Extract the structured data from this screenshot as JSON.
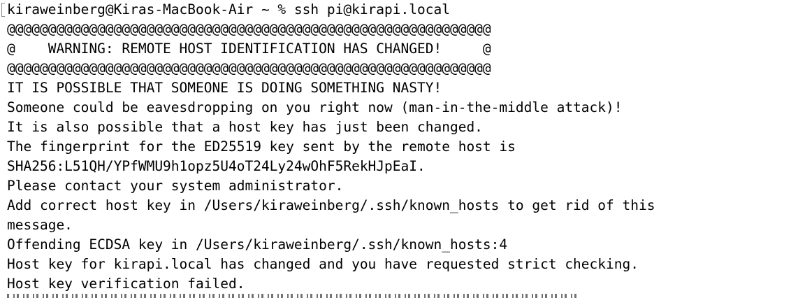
{
  "terminal": {
    "prompt": "kiraweinberg@Kiras-MacBook-Air ~ % ssh pi@kirapi.local",
    "output": [
      "@@@@@@@@@@@@@@@@@@@@@@@@@@@@@@@@@@@@@@@@@@@@@@@@@@@@@@@@@@@",
      "@    WARNING: REMOTE HOST IDENTIFICATION HAS CHANGED!     @",
      "@@@@@@@@@@@@@@@@@@@@@@@@@@@@@@@@@@@@@@@@@@@@@@@@@@@@@@@@@@@",
      "IT IS POSSIBLE THAT SOMEONE IS DOING SOMETHING NASTY!",
      "Someone could be eavesdropping on you right now (man-in-the-middle attack)!",
      "It is also possible that a host key has just been changed.",
      "The fingerprint for the ED25519 key sent by the remote host is",
      "SHA256:L51QH/YPfWMU9h1opz5U4oT24Ly24wOhF5RekHJpEaI.",
      "Please contact your system administrator.",
      "Add correct host key in /Users/kiraweinberg/.ssh/known_hosts to get rid of this",
      "message.",
      "Offending ECDSA key in /Users/kiraweinberg/.ssh/known_hosts:4",
      "Host key for kirapi.local has changed and you have requested strict checking.",
      "Host key verification failed."
    ]
  }
}
